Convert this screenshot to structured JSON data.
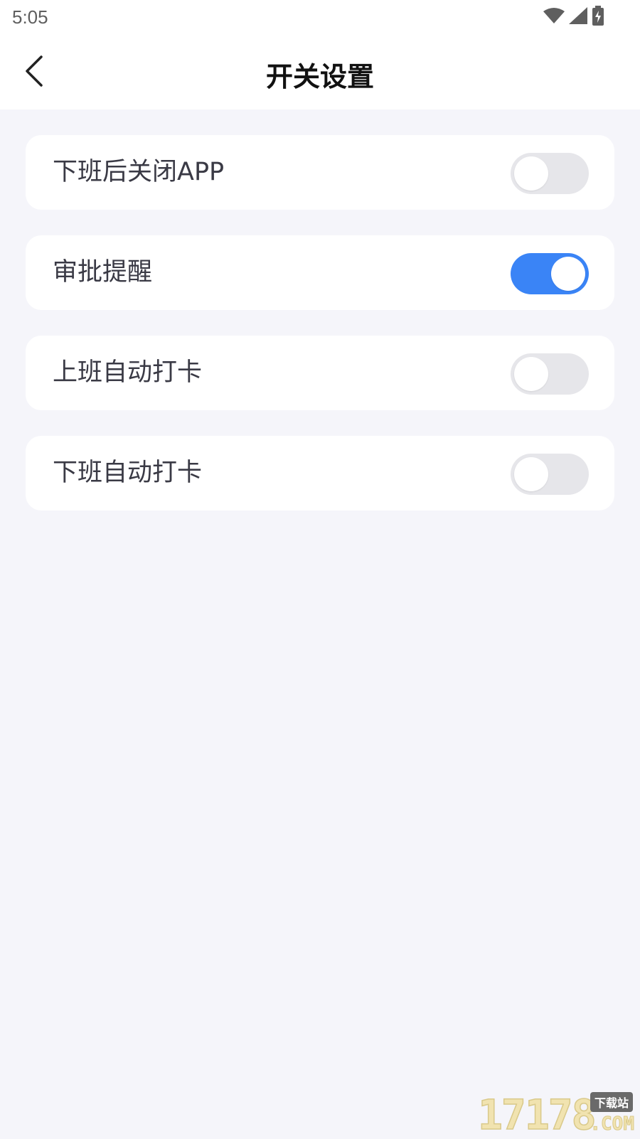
{
  "status_bar": {
    "time": "5:05",
    "icons": [
      "wifi-icon",
      "cellular-signal-icon",
      "battery-charging-icon"
    ]
  },
  "nav": {
    "title": "开关设置",
    "back_icon": "chevron-left-icon"
  },
  "settings": [
    {
      "label": "下班后关闭APP",
      "enabled": false
    },
    {
      "label": "审批提醒",
      "enabled": true
    },
    {
      "label": "上班自动打卡",
      "enabled": false
    },
    {
      "label": "下班自动打卡",
      "enabled": false
    }
  ],
  "colors": {
    "accent": "#3a84f6",
    "toggle_off": "#e6e6ea",
    "background": "#f5f5fa",
    "card": "#ffffff"
  },
  "watermark": {
    "digits": "17178",
    "tag": "下载站",
    "suffix": ".COM"
  }
}
